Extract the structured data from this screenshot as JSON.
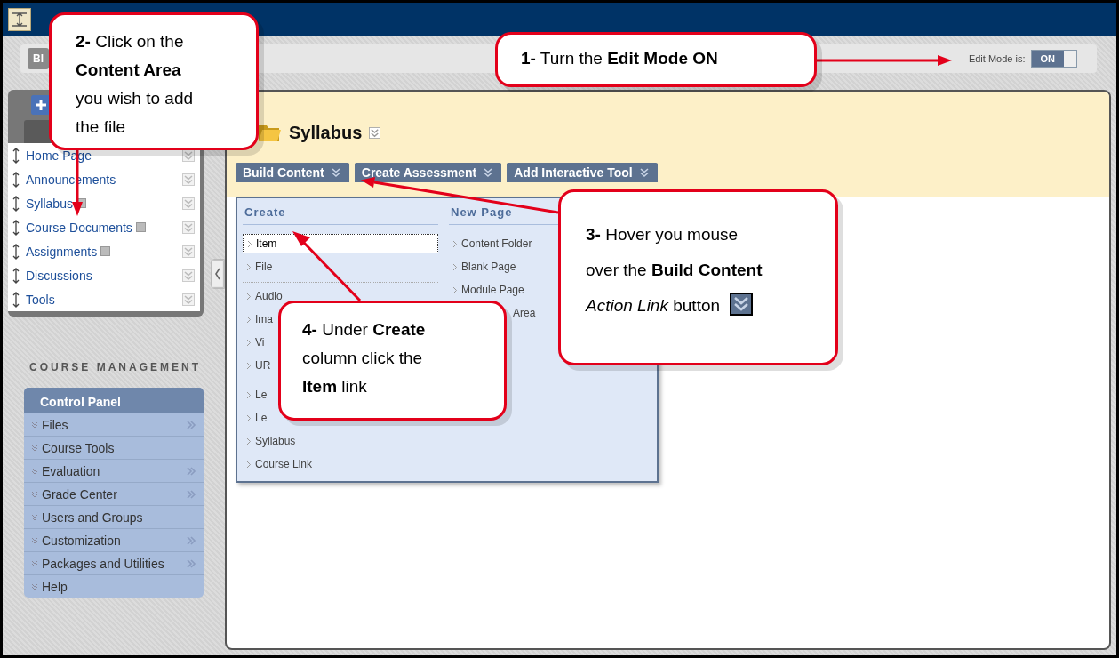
{
  "breadcrumb_tab": "Bl",
  "edit_mode": {
    "label": "Edit Mode is:",
    "toggle": "ON",
    "on": true
  },
  "course_menu": {
    "items": [
      {
        "label": "Home Page",
        "has_page_icon": false
      },
      {
        "label": "Announcements",
        "has_page_icon": false
      },
      {
        "label": "Syllabus",
        "has_page_icon": true
      },
      {
        "label": "Course Documents",
        "has_page_icon": true
      },
      {
        "label": "Assignments",
        "has_page_icon": true
      },
      {
        "label": "Discussions",
        "has_page_icon": false
      },
      {
        "label": "Tools",
        "has_page_icon": false
      }
    ]
  },
  "course_management": {
    "title": "COURSE MANAGEMENT",
    "control_panel": {
      "title": "Control Panel",
      "items": [
        {
          "label": "Files",
          "has_submenu": true
        },
        {
          "label": "Course Tools",
          "has_submenu": false
        },
        {
          "label": "Evaluation",
          "has_submenu": true
        },
        {
          "label": "Grade Center",
          "has_submenu": true
        },
        {
          "label": "Users and Groups",
          "has_submenu": false
        },
        {
          "label": "Customization",
          "has_submenu": true
        },
        {
          "label": "Packages and Utilities",
          "has_submenu": true
        },
        {
          "label": "Help",
          "has_submenu": false
        }
      ]
    }
  },
  "content_area": {
    "title": "Syllabus",
    "action_bar": [
      {
        "label": "Build Content"
      },
      {
        "label": "Create Assessment"
      },
      {
        "label": "Add Interactive Tool"
      }
    ],
    "menu": {
      "columns": [
        {
          "heading": "Create",
          "groups": [
            [
              {
                "label": "Item",
                "focused": true
              },
              {
                "label": "File",
                "focused": false
              }
            ],
            [
              {
                "label": "Audio",
                "focused": false
              },
              {
                "label": "Ima",
                "focused": false
              },
              {
                "label": "Vi",
                "focused": false
              },
              {
                "label": "UR",
                "focused": false
              }
            ],
            [
              {
                "label": "Le",
                "focused": false
              },
              {
                "label": "Le",
                "focused": false
              },
              {
                "label": "Syllabus",
                "focused": false
              },
              {
                "label": "Course Link",
                "focused": false
              }
            ]
          ]
        },
        {
          "heading": "New Page",
          "groups": [
            [
              {
                "label": "Content Folder",
                "focused": false
              },
              {
                "label": "Blank Page",
                "focused": false
              },
              {
                "label": "Module Page",
                "focused": false
              },
              {
                "label": "Area",
                "focused": false
              }
            ]
          ]
        }
      ]
    }
  },
  "callouts": [
    {
      "text": "**1-** Turn the **Edit Mode ON**",
      "has_icon": false
    },
    {
      "text": "**2-** Click on the **Content Area** you wish to add the file",
      "has_icon": false
    },
    {
      "text": "**3-** Hover you mouse\nover the **Build Content**\n*Action Link* button",
      "has_icon": true
    },
    {
      "text": "**4-** Under **Create** column click the **Item** link",
      "has_icon": false
    }
  ]
}
